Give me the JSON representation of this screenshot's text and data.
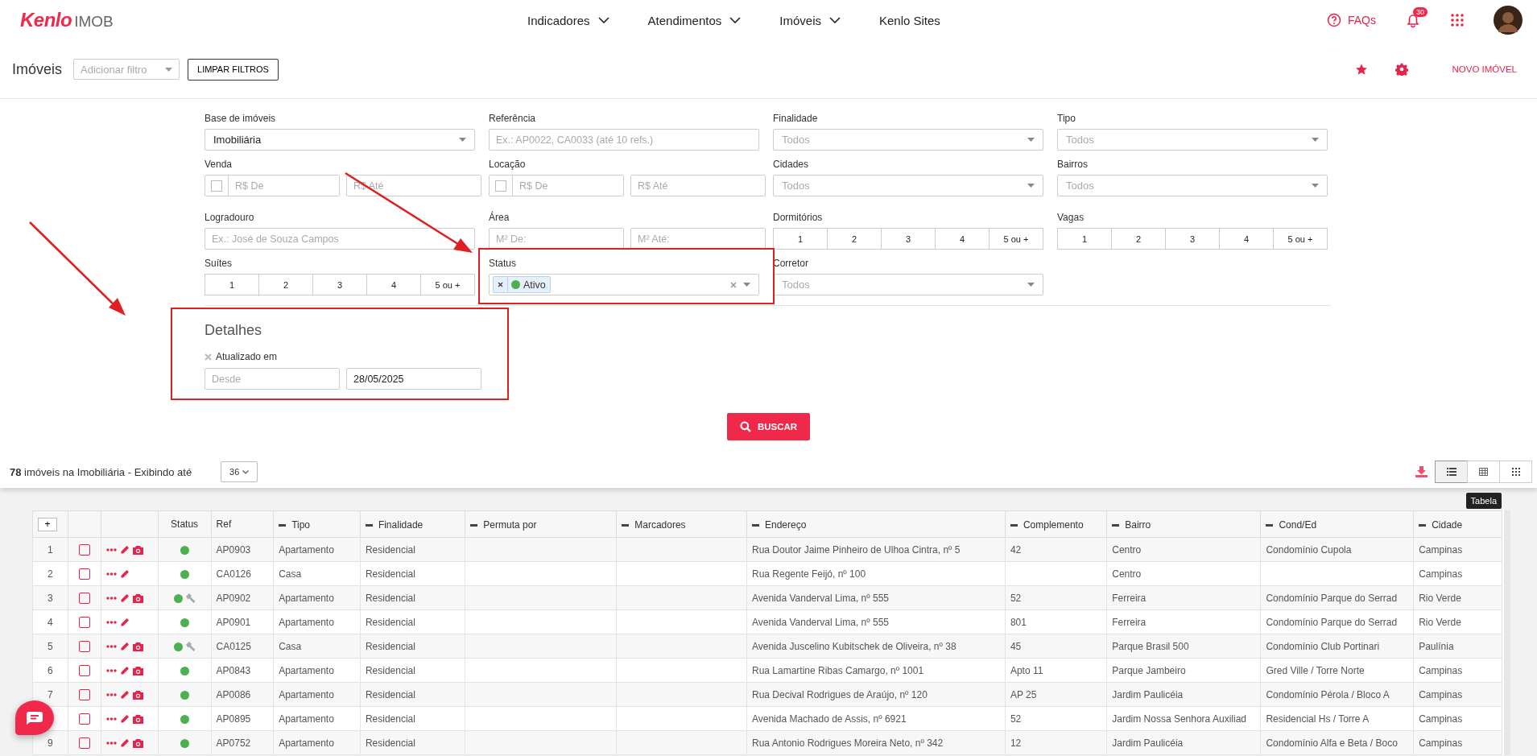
{
  "header": {
    "brand": "Kenlo",
    "product": "IMOB",
    "nav": [
      {
        "label": "Indicadores",
        "dropdown": true
      },
      {
        "label": "Atendimentos",
        "dropdown": true
      },
      {
        "label": "Imóveis",
        "dropdown": true
      },
      {
        "label": "Kenlo Sites",
        "dropdown": false
      }
    ],
    "faq": "FAQs",
    "notifications": "30"
  },
  "toolbar": {
    "title": "Imóveis",
    "filter_placeholder": "Adicionar filtro",
    "clear_button": "LIMPAR FILTROS",
    "new_button": "NOVO IMÓVEL"
  },
  "filters": [
    {
      "kind": "select",
      "label": "Base de imóveis",
      "value": "Imobiliária"
    },
    {
      "kind": "text",
      "label": "Referência",
      "placeholder": "Ex.: AP0022, CA0033 (até 10 refs.)"
    },
    {
      "kind": "select",
      "label": "Finalidade",
      "placeholder": "Todos"
    },
    {
      "kind": "select",
      "label": "Tipo",
      "placeholder": "Todos"
    },
    {
      "kind": "range",
      "label": "Venda",
      "checkbox": true,
      "checked": false,
      "from_placeholder": "R$ De",
      "to_placeholder": "R$ Até"
    },
    {
      "kind": "range",
      "label": "Locação",
      "checkbox": true,
      "checked": false,
      "from_placeholder": "R$ De",
      "to_placeholder": "R$ Até"
    },
    {
      "kind": "select",
      "label": "Cidades",
      "placeholder": "Todos"
    },
    {
      "kind": "select",
      "label": "Bairros",
      "placeholder": "Todos"
    },
    {
      "kind": "text",
      "label": "Logradouro",
      "placeholder": "Ex.: José de Souza Campos"
    },
    {
      "kind": "range",
      "label": "Área",
      "checkbox": false,
      "from_placeholder": "M² De:",
      "to_placeholder": "M² Até:"
    },
    {
      "kind": "buttons",
      "label": "Dormitórios",
      "options": [
        {
          "label": "1",
          "selected": false
        },
        {
          "label": "2",
          "selected": false
        },
        {
          "label": "3",
          "selected": false
        },
        {
          "label": "4",
          "selected": false
        },
        {
          "label": "5 ou +",
          "selected": false
        }
      ]
    },
    {
      "kind": "buttons",
      "label": "Vagas",
      "options": [
        {
          "label": "1",
          "selected": false
        },
        {
          "label": "2",
          "selected": false
        },
        {
          "label": "3",
          "selected": false
        },
        {
          "label": "4",
          "selected": false
        },
        {
          "label": "5 ou +",
          "selected": false
        }
      ]
    },
    {
      "kind": "buttons",
      "label": "Suítes",
      "options": [
        {
          "label": "1",
          "selected": false
        },
        {
          "label": "2",
          "selected": false
        },
        {
          "label": "3",
          "selected": false
        },
        {
          "label": "4",
          "selected": false
        },
        {
          "label": "5 ou +",
          "selected": false
        }
      ]
    },
    {
      "kind": "tags",
      "label": "Status",
      "tags": [
        {
          "label": "Ativo",
          "color": "#4caf50"
        }
      ]
    },
    {
      "kind": "select",
      "label": "Corretor",
      "placeholder": "Todos"
    }
  ],
  "details": {
    "title": "Detalhes",
    "field_label": "Atualizado em",
    "from_placeholder": "Desde",
    "to_value": "28/05/2025"
  },
  "search_button": "BUSCAR",
  "results": {
    "summary": "**78** imóveis na Imobiliária - Exibindo até",
    "page_size": "36",
    "views": [
      {
        "kind": "list",
        "selected": true
      },
      {
        "kind": "table",
        "selected": false
      },
      {
        "kind": "grid",
        "selected": false
      }
    ],
    "tooltip": "Tabela"
  },
  "table": {
    "add_column": "+",
    "columns": [
      {
        "label": "Status",
        "removable": false
      },
      {
        "label": "Ref",
        "removable": false
      },
      {
        "label": "Tipo",
        "removable": true
      },
      {
        "label": "Finalidade",
        "removable": true
      },
      {
        "label": "Permuta por",
        "removable": true
      },
      {
        "label": "Marcadores",
        "removable": true
      },
      {
        "label": "Endereço",
        "removable": true
      },
      {
        "label": "Complemento",
        "removable": true
      },
      {
        "label": "Bairro",
        "removable": true
      },
      {
        "label": "Cond/Ed",
        "removable": true
      },
      {
        "label": "Cidade",
        "removable": true
      }
    ],
    "rows": [
      {
        "num": "1",
        "checked": false,
        "photo": true,
        "hammer": false,
        "ref": "AP0903",
        "tipo": "Apartamento",
        "finalidade": "Residencial",
        "endereco": "Rua Doutor Jaime Pinheiro de Ulhoa Cintra, nº 5",
        "complemento": "42",
        "bairro": "Centro",
        "cond": "Condomínio Cupola",
        "cidade": "Campinas"
      },
      {
        "num": "2",
        "checked": false,
        "photo": false,
        "hammer": false,
        "ref": "CA0126",
        "tipo": "Casa",
        "finalidade": "Residencial",
        "endereco": "Rua Regente Feijó, nº 100",
        "bairro": "Centro",
        "cidade": "Campinas"
      },
      {
        "num": "3",
        "checked": false,
        "photo": true,
        "hammer": true,
        "ref": "AP0902",
        "tipo": "Apartamento",
        "finalidade": "Residencial",
        "endereco": "Avenida Vanderval Lima, nº 555",
        "complemento": "52",
        "bairro": "Ferreira",
        "cond": "Condomínio Parque do Serrad",
        "cidade": "Rio Verde"
      },
      {
        "num": "4",
        "checked": false,
        "photo": false,
        "hammer": false,
        "ref": "AP0901",
        "tipo": "Apartamento",
        "finalidade": "Residencial",
        "endereco": "Avenida Vanderval Lima, nº 555",
        "complemento": "801",
        "bairro": "Ferreira",
        "cond": "Condomínio Parque do Serrad",
        "cidade": "Rio Verde"
      },
      {
        "num": "5",
        "checked": false,
        "photo": true,
        "hammer": true,
        "ref": "CA0125",
        "tipo": "Casa",
        "finalidade": "Residencial",
        "endereco": "Avenida Juscelino Kubitschek de Oliveira, nº 38",
        "complemento": "45",
        "bairro": "Parque Brasil 500",
        "cond": "Condomínio Club Portinari",
        "cidade": "Paulínia"
      },
      {
        "num": "6",
        "checked": false,
        "photo": true,
        "hammer": false,
        "ref": "AP0843",
        "tipo": "Apartamento",
        "finalidade": "Residencial",
        "endereco": "Rua Lamartine Ribas Camargo, nº 1001",
        "complemento": "Apto 11",
        "bairro": "Parque Jambeiro",
        "cond": "Gred Ville / Torre Norte",
        "cidade": "Campinas"
      },
      {
        "num": "7",
        "checked": false,
        "photo": true,
        "hammer": false,
        "ref": "AP0086",
        "tipo": "Apartamento",
        "finalidade": "Residencial",
        "endereco": "Rua Decival Rodrigues de Araújo, nº 120",
        "complemento": "AP 25",
        "bairro": "Jardim Paulicéia",
        "cond": "Condomínio Pérola / Bloco A",
        "cidade": "Campinas"
      },
      {
        "checked": false,
        "photo": true,
        "hammer": false,
        "ref": "AP0895",
        "tipo": "Apartamento",
        "finalidade": "Residencial",
        "endereco": "Avenida Machado de Assis, nº 6921",
        "complemento": "52",
        "bairro": "Jardim Nossa Senhora Auxiliad",
        "cond": "Residencial Hs / Torre A",
        "cidade": "Campinas"
      },
      {
        "num": "9",
        "checked": false,
        "photo": true,
        "hammer": false,
        "ref": "AP0752",
        "tipo": "Apartamento",
        "finalidade": "Residencial",
        "endereco": "Rua Antonio Rodrigues Moreira Neto, nº 342",
        "complemento": "12",
        "bairro": "Jardim Paulicéia",
        "cond": "Condomínio Alfa e Beta / Boco",
        "cidade": "Campinas"
      }
    ]
  }
}
